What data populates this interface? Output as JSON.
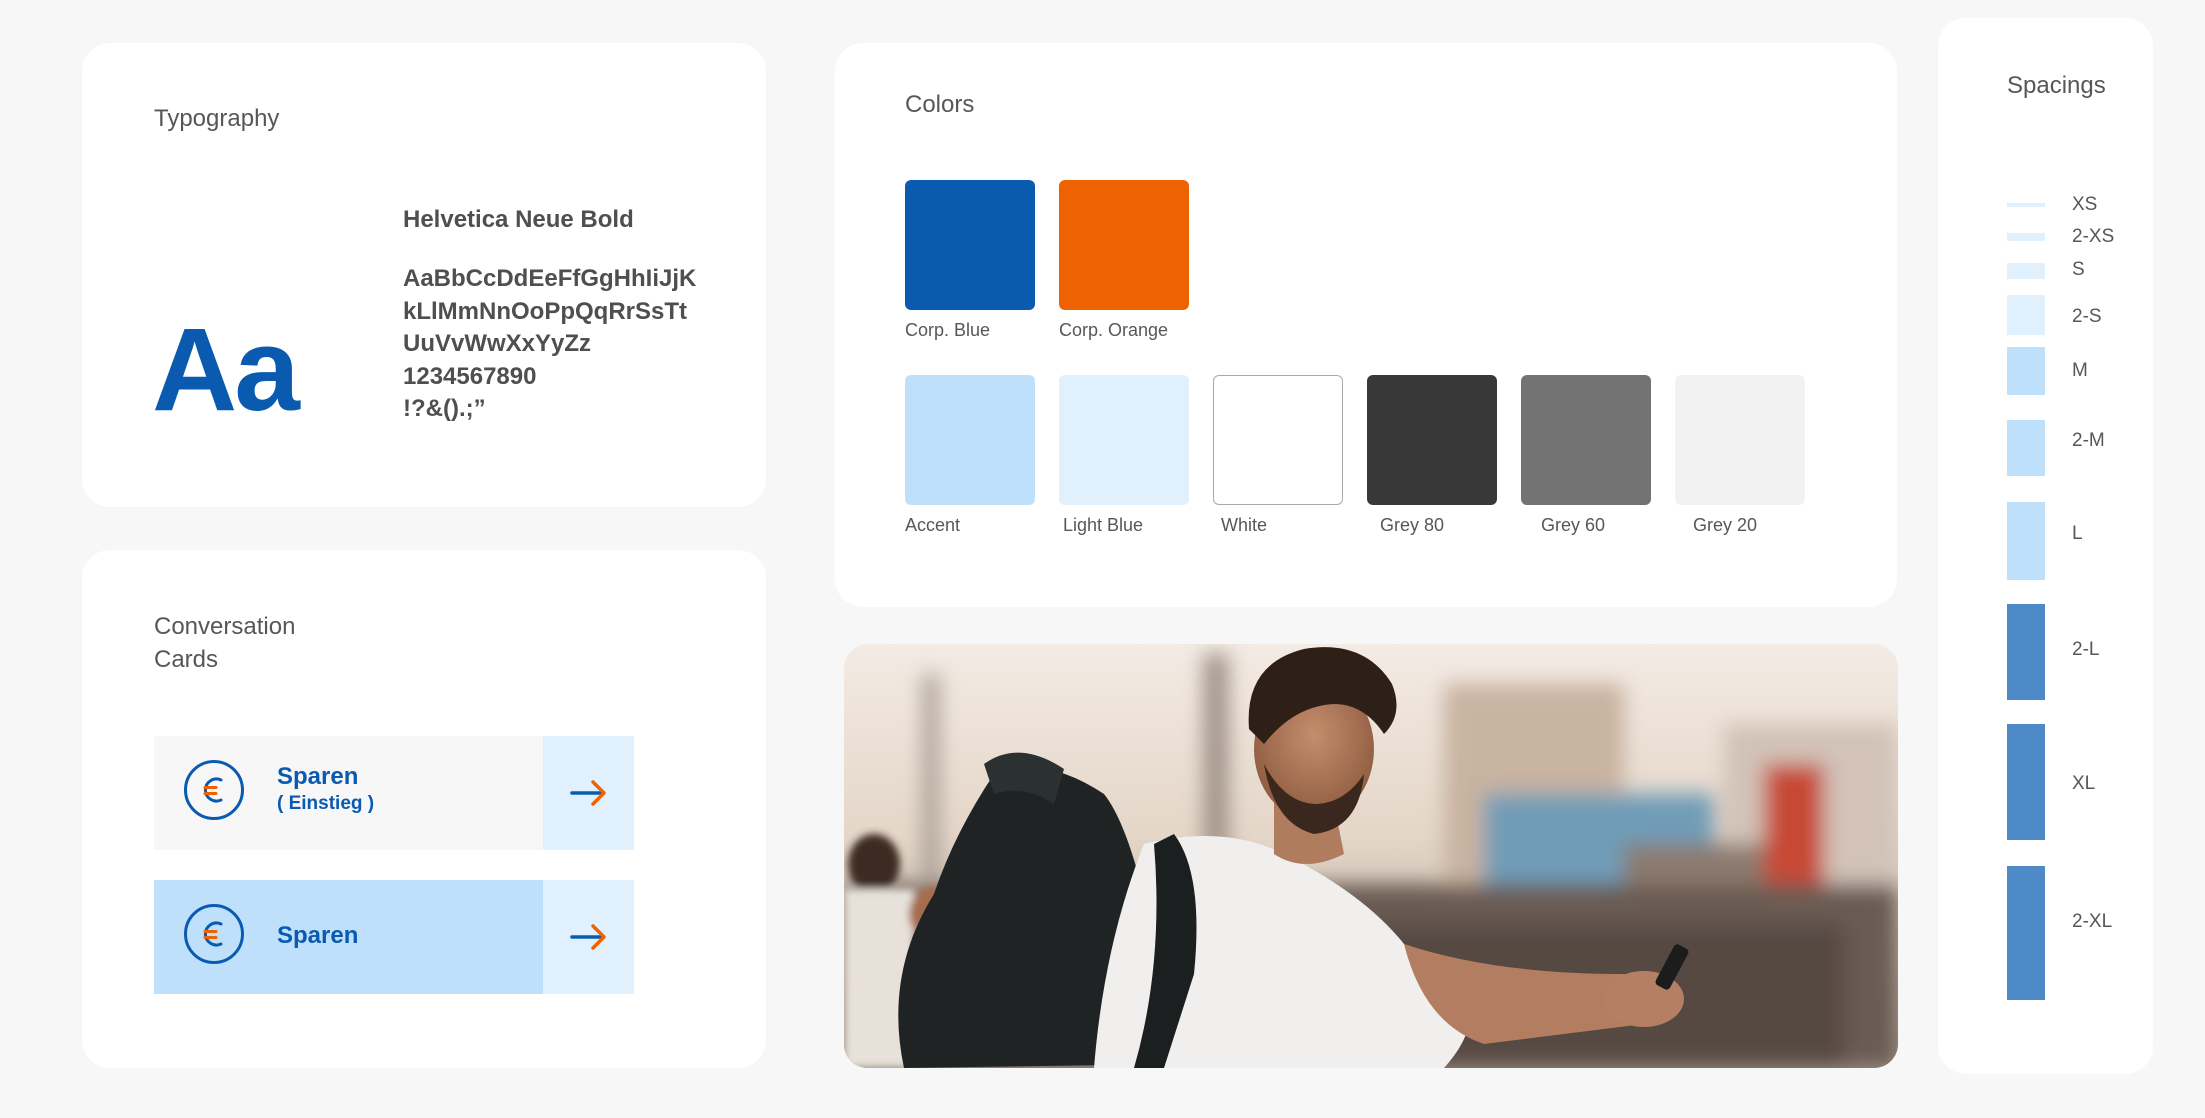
{
  "colors_theme": {
    "corp_blue": "#0a5bb0",
    "corp_orange": "#ef6201",
    "accent": "#bfe0fb",
    "light_blue": "#e0f0fd",
    "white": "#ffffff",
    "grey_80": "#383838",
    "grey_60": "#737373",
    "grey_20": "#f2f2f2",
    "spacing_dark": "#4d8ac7"
  },
  "typography": {
    "title": "Typography",
    "sample": "Aa",
    "font_name": "Helvetica Neue Bold",
    "glyph_lines": [
      "AaBbCcDdEeFfGgHhIiJjK",
      "kLlMmNnOoPpQqRrSsTt",
      "UuVvWwXxYyZz",
      "1234567890",
      "!?&().;”"
    ]
  },
  "conversation": {
    "title_line1": "Conversation",
    "title_line2": "Cards",
    "cards": [
      {
        "label": "Sparen",
        "sub": "( Einstieg )",
        "icon": "euro-icon",
        "arrow": "arrow-right-icon"
      },
      {
        "label": "Sparen",
        "icon": "euro-icon",
        "arrow": "arrow-right-icon"
      }
    ]
  },
  "colors": {
    "title": "Colors",
    "primary": [
      {
        "name": "Corp. Blue",
        "hex": "#0a5bb0"
      },
      {
        "name": "Corp. Orange",
        "hex": "#ef6201"
      }
    ],
    "secondary": [
      {
        "name": "Accent",
        "hex": "#bfe0fb"
      },
      {
        "name": "Light Blue",
        "hex": "#e0f0fd"
      },
      {
        "name": "White",
        "hex": "#ffffff"
      },
      {
        "name": "Grey 80",
        "hex": "#383838"
      },
      {
        "name": "Grey 60",
        "hex": "#737373"
      },
      {
        "name": "Grey 20",
        "hex": "#f2f2f2"
      }
    ]
  },
  "spacings": {
    "title": "Spacings",
    "items": [
      {
        "label": "XS"
      },
      {
        "label": "2-XS"
      },
      {
        "label": "S"
      },
      {
        "label": "2-S"
      },
      {
        "label": "M"
      },
      {
        "label": "2-M"
      },
      {
        "label": "L"
      },
      {
        "label": "2-L"
      },
      {
        "label": "XL"
      },
      {
        "label": "2-XL"
      }
    ]
  }
}
